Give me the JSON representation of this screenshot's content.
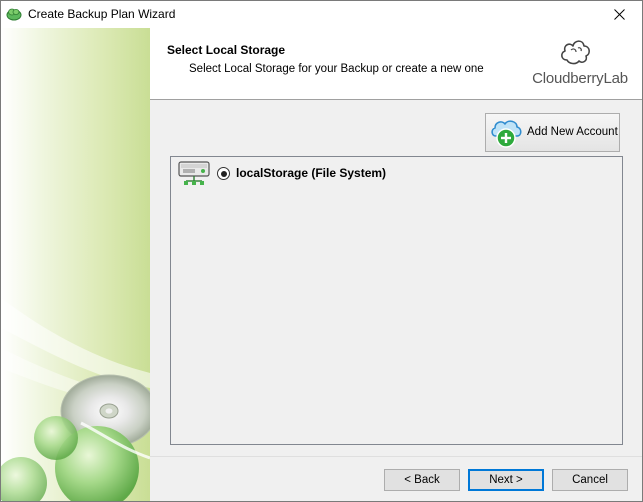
{
  "window": {
    "title": "Create Backup Plan Wizard",
    "close_icon": "close-icon",
    "app_icon": "cloudberry-app-icon"
  },
  "header": {
    "title": "Select Local Storage",
    "subtitle": "Select Local Storage for your Backup or create a new one",
    "logo_text": "CloudberryLab"
  },
  "toolbar": {
    "add_account_label": "Add New Account",
    "add_account_icon": "cloud-add-icon"
  },
  "storage": {
    "items": [
      {
        "label": "localStorage (File System)",
        "selected": true,
        "icon": "local-drive-icon"
      }
    ]
  },
  "footer": {
    "back_label": "< Back",
    "next_label": "Next >",
    "cancel_label": "Cancel"
  },
  "colors": {
    "accent": "#0078d7",
    "side_panel_green": "#c9de95",
    "add_icon_green": "#2eaa3c",
    "cloud_blue": "#4aa3df"
  }
}
